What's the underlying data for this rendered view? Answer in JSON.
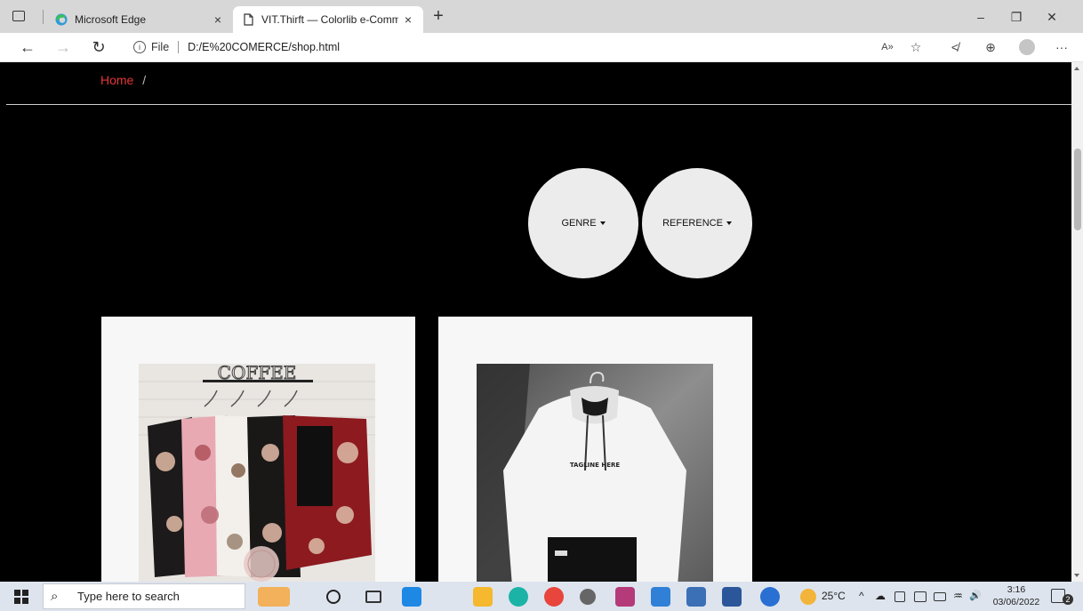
{
  "browser": {
    "tabs": [
      {
        "title": "Microsoft Edge",
        "close": "×"
      },
      {
        "title": "VIT.Thirft — Colorlib e-Commerce",
        "close": "×"
      }
    ],
    "new_tab": "+",
    "window_controls": {
      "minimize": "–",
      "restore": "❐",
      "close": "✕"
    },
    "nav": {
      "back": "←",
      "forward": "→",
      "refresh": "↻"
    },
    "address": {
      "info": "i",
      "scheme_label": "File",
      "url": "D:/E%20COMERCE/shop.html"
    },
    "toolbar_icons": [
      "read-aloud-icon",
      "favorite-add-icon",
      "favorites-icon",
      "collections-icon",
      "profile-icon",
      "more-icon"
    ],
    "toolbar_glyphs": {
      "read_aloud": "A»",
      "favorite_add": "☆",
      "favorites": "≮",
      "collections": "⊕",
      "more": "···"
    }
  },
  "page": {
    "breadcrumb": {
      "home": "Home",
      "separator": "/"
    },
    "filters": [
      {
        "label": "GENRE"
      },
      {
        "label": "REFERENCE"
      }
    ],
    "products": [
      {
        "image": "floral-blouses-on-hangers"
      },
      {
        "image": "white-hoodie-on-hanger"
      }
    ]
  },
  "taskbar": {
    "search_placeholder": "Type here to search",
    "weather": "25°C",
    "time": "3:16",
    "date": "03/06/2022",
    "notifications": "2",
    "tray_glyphs": {
      "chevron": "^",
      "cloud": "☁",
      "volume": "🔊",
      "network": "♒"
    }
  },
  "colors": {
    "accent": "#e53637",
    "page_bg": "#000000",
    "card_bg": "#f7f7f7",
    "filter_bg": "#ececec"
  }
}
